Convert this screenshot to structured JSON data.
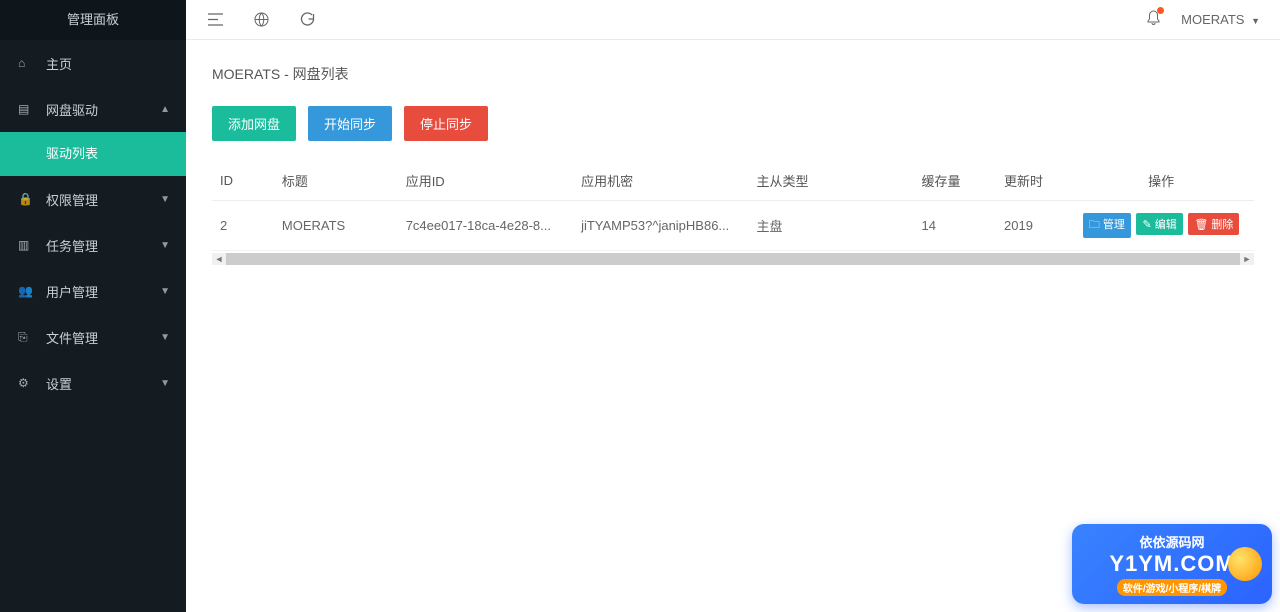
{
  "sidebar": {
    "title": "管理面板",
    "items": [
      {
        "icon": "⌂",
        "label": "主页"
      },
      {
        "icon": "▤",
        "label": "网盘驱动",
        "expanded": true,
        "children": [
          {
            "label": "驱动列表",
            "active": true
          }
        ]
      },
      {
        "icon": "🔒",
        "label": "权限管理"
      },
      {
        "icon": "▥",
        "label": "任务管理"
      },
      {
        "icon": "👥",
        "label": "用户管理"
      },
      {
        "icon": "⎘",
        "label": "文件管理"
      },
      {
        "icon": "⚙",
        "label": "设置"
      }
    ]
  },
  "topbar": {
    "user": "MOERATS"
  },
  "page": {
    "title": "MOERATS - 网盘列表",
    "buttons": {
      "add": "添加网盘",
      "sync": "开始同步",
      "stop": "停止同步"
    }
  },
  "table": {
    "headers": {
      "id": "ID",
      "title": "标题",
      "appid": "应用ID",
      "secret": "应用机密",
      "type": "主从类型",
      "cache": "缓存量",
      "update": "更新时",
      "ops": "操作"
    },
    "rows": [
      {
        "id": "2",
        "title": "MOERATS",
        "appid": "7c4ee017-18ca-4e28-8...",
        "secret": "jiTYAMP53?^janipHB86...",
        "type": "主盘",
        "cache": "14",
        "update": "2019"
      }
    ],
    "ops": {
      "manage": "管理",
      "edit": "编辑",
      "delete": "删除"
    }
  },
  "promo": {
    "top": "依依源码网",
    "main": "Y1YM.COM",
    "sub": "软件/游戏/小程序/棋牌"
  }
}
